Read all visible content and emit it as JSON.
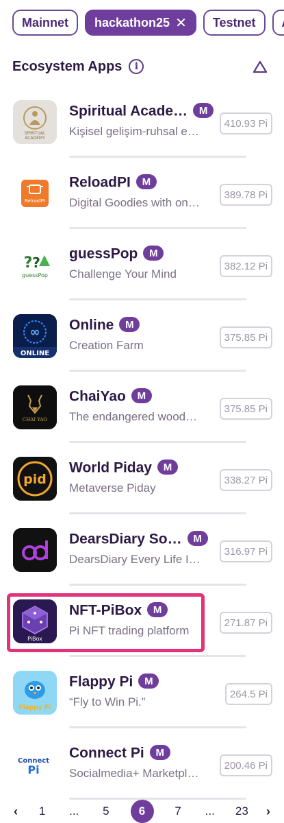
{
  "filters": [
    {
      "label": "Mainnet",
      "active": false
    },
    {
      "label": "hackathon25",
      "active": true,
      "clear_symbol": "✕"
    },
    {
      "label": "Testnet",
      "active": false
    },
    {
      "label": "A",
      "active": false
    }
  ],
  "section": {
    "title": "Ecosystem Apps",
    "info_symbol": "i"
  },
  "apps": [
    {
      "name": "Spiritual Acade…",
      "badge": "M",
      "description": "Kişisel gelişim-ruhsal e…",
      "price": "410.93 Pi",
      "icon_text": "SPIRITUAL ACADEMY",
      "icon": "spiritual-academy-logo"
    },
    {
      "name": "ReloadPI",
      "badge": "M",
      "description": "Digital Goodies with on…",
      "price": "389.78 Pi",
      "icon_text": "ReloadPI",
      "icon": "reloadpi-logo"
    },
    {
      "name": "guessPop",
      "badge": "M",
      "description": "Challenge Your Mind",
      "price": "382.12 Pi",
      "icon_text": "guessPop",
      "icon": "guesspop-logo"
    },
    {
      "name": "Online",
      "badge": "M",
      "description": "Creation Farm",
      "price": "375.85 Pi",
      "icon_text": "ONLINE",
      "icon": "online-logo"
    },
    {
      "name": "ChaiYao",
      "badge": "M",
      "description": "The endangered wood…",
      "price": "375.85 Pi",
      "icon_text": "CHAI YAO",
      "icon": "chaiyao-logo"
    },
    {
      "name": "World Piday",
      "badge": "M",
      "description": "Metaverse Piday",
      "price": "338.27 Pi",
      "icon_text": "pid",
      "icon": "world-piday-logo"
    },
    {
      "name": "DearsDiary So…",
      "badge": "M",
      "description": "DearsDiary Every Life I…",
      "price": "316.97 Pi",
      "icon_text": "",
      "icon": "dearsdiary-logo"
    },
    {
      "name": "NFT-PiBox",
      "badge": "M",
      "description": "Pi NFT trading platform",
      "price": "271.87 Pi",
      "icon_text": "PiBox",
      "icon": "pibox-logo"
    },
    {
      "name": "Flappy Pi",
      "badge": "M",
      "description": "“Fly to Win Pi.”",
      "price": "264.5 Pi",
      "icon_text": "Flappy Pi",
      "icon": "flappy-pi-logo"
    },
    {
      "name": "Connect Pi",
      "badge": "M",
      "description": "Socialmedia+ Marketpl…",
      "price": "200.46 Pi",
      "icon_text": "Connect Pi",
      "icon": "connect-pi-logo"
    }
  ],
  "pagination": {
    "prev": "‹",
    "items": [
      "1",
      "...",
      "5",
      "6",
      "7",
      "...",
      "23"
    ],
    "current": "6",
    "next": "›"
  },
  "colors": {
    "brand": "#6f3e9c",
    "highlight": "#e2327a"
  }
}
